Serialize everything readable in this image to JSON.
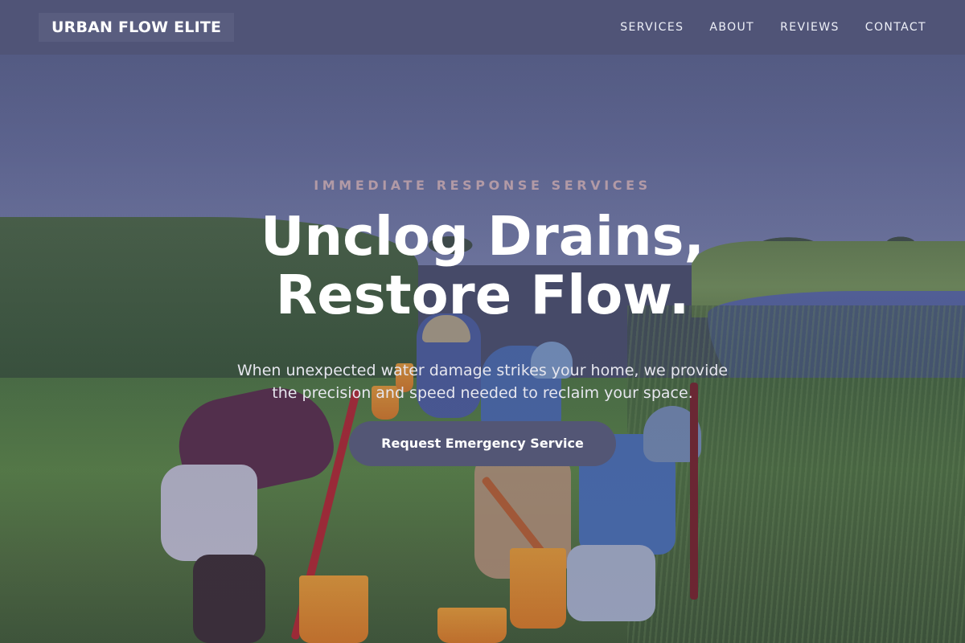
{
  "header": {
    "logo_text": "URBAN FLOW ELITE",
    "nav": [
      {
        "label": "SERVICES"
      },
      {
        "label": "ABOUT"
      },
      {
        "label": "REVIEWS"
      },
      {
        "label": "CONTACT"
      }
    ]
  },
  "hero": {
    "eyebrow": "IMMEDIATE RESPONSE SERVICES",
    "headline_line1": "Unclog Drains,",
    "headline_line2": "Restore Flow.",
    "subtext_line1": "When unexpected water damage strikes your home, we provide",
    "subtext_line2": "the precision and speed needed to reclaim your space.",
    "cta_label": "Request Emergency Service"
  },
  "colors": {
    "header_bg": "#505476",
    "eyebrow": "#b29aa6",
    "cta_bg": "#535675",
    "text_primary": "#ffffff"
  }
}
